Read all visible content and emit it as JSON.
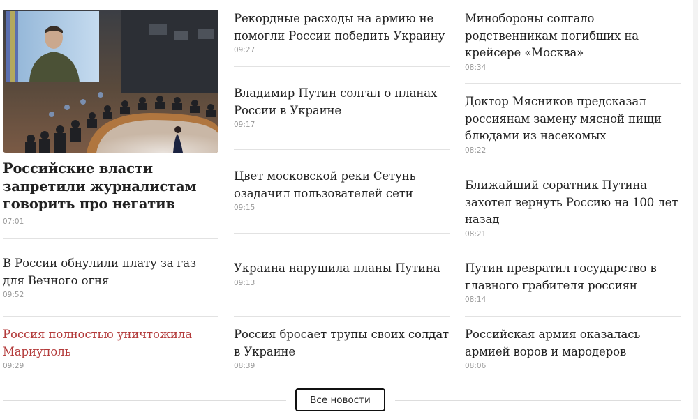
{
  "col1": {
    "hero": {
      "title": "Российские власти запретили журналистам говорить про негатив",
      "time": "07:01"
    },
    "items": [
      {
        "title": "В России обнулили плату за газ для Вечного огня",
        "time": "09:52"
      },
      {
        "title": "Россия полностью уничтожила Мариуполь",
        "time": "09:29"
      }
    ]
  },
  "col2": {
    "items": [
      {
        "title": "Рекордные расходы на армию не помогли России победить Украину",
        "time": "09:27"
      },
      {
        "title": "Владимир Путин солгал о планах России в Украине",
        "time": "09:17"
      },
      {
        "title": "Цвет московской реки Сетунь озадачил пользователей сети",
        "time": "09:15"
      },
      {
        "title": "Украина нарушила планы Путина",
        "time": "09:13"
      },
      {
        "title": "Россия бросает трупы своих солдат в Украине",
        "time": "08:39"
      }
    ]
  },
  "col3": {
    "items": [
      {
        "title": "Минобороны солгало родственникам погибших на крейсере «Москва»",
        "time": "08:34"
      },
      {
        "title": "Доктор Мясников предсказал россиянам замену мясной пищи блюдами из насекомых",
        "time": "08:22"
      },
      {
        "title": "Ближайший соратник Путина захотел вернуть Россию на 100 лет назад",
        "time": "08:21"
      },
      {
        "title": "Путин превратил государство в главного грабителя россиян",
        "time": "08:14"
      },
      {
        "title": "Российская армия оказалась армией воров и мародеров",
        "time": "08:06"
      }
    ]
  },
  "footer": {
    "all_news_label": "Все новости"
  },
  "colors": {
    "text": "#222222",
    "highlight": "#b33a3a",
    "time": "#999999",
    "separator": "#e2e2e2"
  }
}
